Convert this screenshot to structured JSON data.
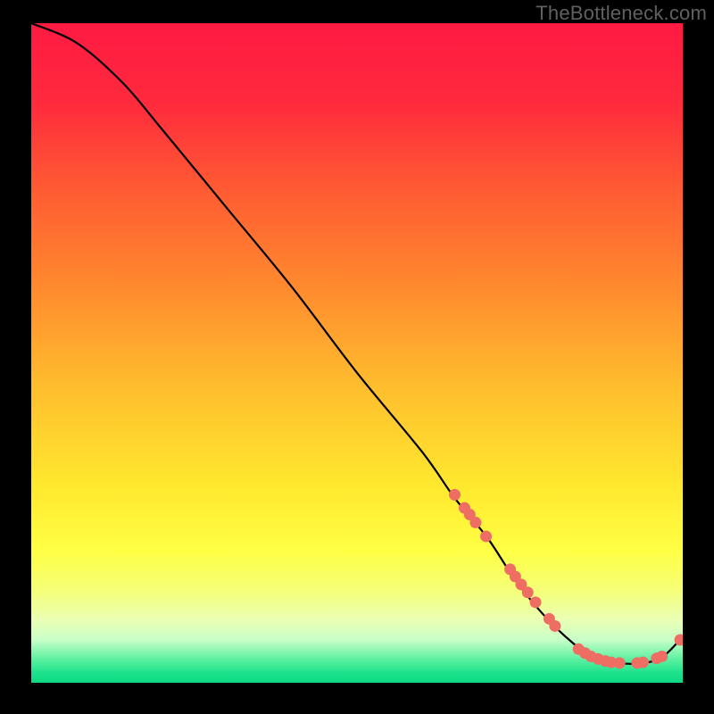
{
  "watermark": "TheBottleneck.com",
  "chart_data": {
    "type": "line",
    "title": "",
    "xlabel": "",
    "ylabel": "",
    "xlim": [
      0,
      100
    ],
    "ylim": [
      0,
      100
    ],
    "gradient_stops": [
      {
        "offset": 0.0,
        "color": "#ff1a42"
      },
      {
        "offset": 0.12,
        "color": "#ff2a3d"
      },
      {
        "offset": 0.25,
        "color": "#ff5a33"
      },
      {
        "offset": 0.4,
        "color": "#ff8a2e"
      },
      {
        "offset": 0.55,
        "color": "#ffbd2e"
      },
      {
        "offset": 0.7,
        "color": "#ffe82e"
      },
      {
        "offset": 0.8,
        "color": "#ffff44"
      },
      {
        "offset": 0.86,
        "color": "#f5ff78"
      },
      {
        "offset": 0.905,
        "color": "#eaffb4"
      },
      {
        "offset": 0.935,
        "color": "#c8ffc8"
      },
      {
        "offset": 0.965,
        "color": "#5af0a0"
      },
      {
        "offset": 0.985,
        "color": "#1de28c"
      },
      {
        "offset": 1.0,
        "color": "#0fd984"
      }
    ],
    "series": [
      {
        "name": "bottleneck-curve",
        "type": "line",
        "x": [
          0,
          7,
          14,
          20,
          30,
          40,
          50,
          60,
          65,
          70,
          74,
          78,
          82,
          86,
          90,
          94,
          97,
          100
        ],
        "y": [
          100,
          97,
          91,
          84,
          72,
          60,
          47,
          35,
          28,
          22,
          16,
          11,
          7,
          4,
          3,
          3,
          4,
          7
        ]
      },
      {
        "name": "highlight-points",
        "type": "scatter",
        "color": "#ef6e64",
        "x": [
          65.0,
          66.5,
          67.3,
          68.2,
          69.8,
          73.5,
          74.3,
          75.2,
          76.2,
          77.4,
          79.5,
          80.4,
          84.0,
          85.0,
          85.9,
          87.0,
          88.1,
          89.0,
          90.3,
          93.0,
          93.9,
          96.0,
          96.8,
          99.6
        ],
        "y": [
          28.5,
          26.5,
          25.5,
          24.3,
          22.2,
          17.2,
          16.1,
          14.9,
          13.7,
          12.2,
          9.7,
          8.6,
          5.1,
          4.5,
          4.0,
          3.6,
          3.3,
          3.1,
          3.0,
          3.0,
          3.1,
          3.7,
          4.0,
          6.5
        ]
      }
    ]
  }
}
